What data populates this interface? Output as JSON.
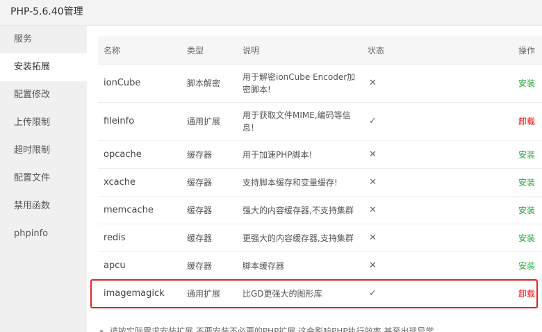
{
  "window": {
    "title": "PHP-5.6.40管理"
  },
  "sidebar": {
    "items": [
      {
        "label": "服务",
        "active": false
      },
      {
        "label": "安装拓展",
        "active": true
      },
      {
        "label": "配置修改",
        "active": false
      },
      {
        "label": "上传限制",
        "active": false
      },
      {
        "label": "超时限制",
        "active": false
      },
      {
        "label": "配置文件",
        "active": false
      },
      {
        "label": "禁用函数",
        "active": false
      },
      {
        "label": "phpinfo",
        "active": false
      }
    ]
  },
  "table": {
    "headers": {
      "name": "名称",
      "type": "类型",
      "desc": "说明",
      "status": "状态",
      "action": "操作"
    },
    "rows": [
      {
        "name": "ionCube",
        "type": "脚本解密",
        "desc": "用于解密ionCube Encoder加密脚本!",
        "status": "✕",
        "action": "安装",
        "installed": false
      },
      {
        "name": "fileinfo",
        "type": "通用扩展",
        "desc": "用于获取文件MIME,编码等信息!",
        "status": "✓",
        "action": "卸载",
        "installed": true
      },
      {
        "name": "opcache",
        "type": "缓存器",
        "desc": "用于加速PHP脚本!",
        "status": "✕",
        "action": "安装",
        "installed": false
      },
      {
        "name": "xcache",
        "type": "缓存器",
        "desc": "支持脚本缓存和变量缓存!",
        "status": "✕",
        "action": "安装",
        "installed": false
      },
      {
        "name": "memcache",
        "type": "缓存器",
        "desc": "强大的内容缓存器,不支持集群",
        "status": "✕",
        "action": "安装",
        "installed": false
      },
      {
        "name": "redis",
        "type": "缓存器",
        "desc": "更强大的内容缓存器,支持集群",
        "status": "✕",
        "action": "安装",
        "installed": false
      },
      {
        "name": "apcu",
        "type": "缓存器",
        "desc": "脚本缓存器",
        "status": "✕",
        "action": "安装",
        "installed": false
      },
      {
        "name": "imagemagick",
        "type": "通用扩展",
        "desc": "比GD更强大的图形库",
        "status": "✓",
        "action": "卸载",
        "installed": true
      }
    ]
  },
  "notice": {
    "text": "请按实际需求安装扩展,不要安装不必要的PHP扩展,这会影响PHP执行效率,甚至出现异常"
  },
  "colors": {
    "install": "#20a53a",
    "uninstall": "#ff0000",
    "highlight": "#e02424"
  }
}
